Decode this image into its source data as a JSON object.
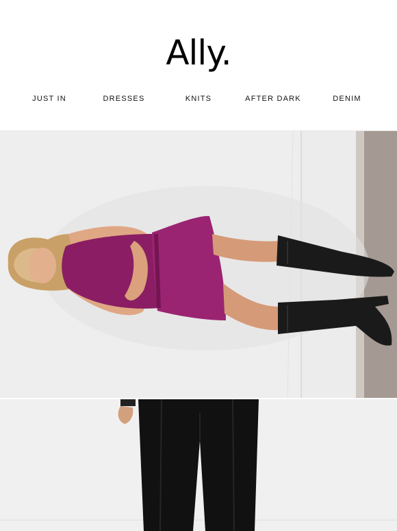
{
  "brand": {
    "logo_text": "Ally."
  },
  "nav": {
    "items": [
      {
        "label": "JUST IN"
      },
      {
        "label": "DRESSES"
      },
      {
        "label": "KNITS"
      },
      {
        "label": "AFTER DARK"
      },
      {
        "label": "DENIM"
      }
    ]
  },
  "colors": {
    "background": "#ffffff",
    "text": "#111111",
    "dress": "#8a1d63",
    "boots": "#1a1a1a",
    "wall": "#ededed",
    "floor": "#9c928c"
  },
  "images": {
    "hero": {
      "subject": "model-magenta-dress-black-knee-boots"
    },
    "second": {
      "subject": "model-black-wide-leg-pants"
    }
  }
}
